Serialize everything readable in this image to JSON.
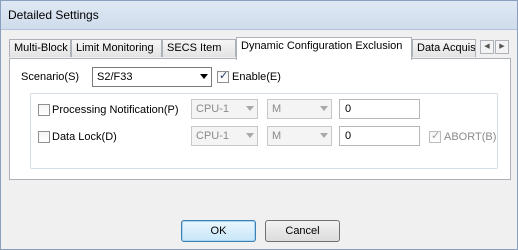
{
  "window": {
    "title": "Detailed Settings"
  },
  "tabs": [
    {
      "label": "Multi-Block"
    },
    {
      "label": "Limit Monitoring"
    },
    {
      "label": "SECS Item"
    },
    {
      "label": "Dynamic Configuration Exclusion",
      "active": true
    },
    {
      "label": "Data Acquisi"
    }
  ],
  "tab_scroll": {
    "left_icon": "scroll-left-icon",
    "right_icon": "scroll-right-icon"
  },
  "scenario": {
    "label": "Scenario(S)",
    "value": "S2/F33",
    "enable_label": "Enable(E)",
    "enable_checked": true
  },
  "processing_notification": {
    "label": "Processing Notification(P)",
    "checked": false,
    "cpu": "CPU-1",
    "device": "M",
    "address": "0"
  },
  "data_lock": {
    "label": "Data Lock(D)",
    "checked": false,
    "cpu": "CPU-1",
    "device": "M",
    "address": "0",
    "abort_label": "ABORT(B)",
    "abort_checked": true
  },
  "buttons": {
    "ok": "OK",
    "cancel": "Cancel"
  }
}
